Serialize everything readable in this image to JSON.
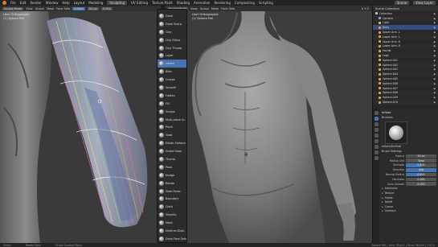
{
  "menubar": {
    "items": [
      "File",
      "Edit",
      "Render",
      "Window",
      "Help",
      "Layout",
      "Modeling",
      "Sculpting",
      "UV Editing",
      "Texture Paint",
      "Shading",
      "Animation",
      "Rendering",
      "Compositing",
      "Scripting"
    ],
    "workspace": "Scene",
    "view_layer": "View Layer"
  },
  "toolbar_left": {
    "mode": "Sculpt Mode",
    "items": [
      "View",
      "Sculpt",
      "Mask",
      "Face Sets"
    ],
    "brush": "Inflate",
    "radius": "50 px",
    "strength": "0.500"
  },
  "toolbar_right": {
    "mode": "Sculpt Mode",
    "items": [
      "View",
      "Sculpt",
      "Mask",
      "Face Sets"
    ],
    "xyz": "X Y Z"
  },
  "viewport_left": {
    "line1": "User Orthographic",
    "line2": "(1) Sphere Pell"
  },
  "viewport_right": {
    "line1": "User Orthographic",
    "line2": "(1) Sphere Pell"
  },
  "brush_menu": {
    "items": [
      "Draw",
      "Draw Sharp",
      "Clay",
      "Clay Strips",
      "Clay Thumb",
      "Layer",
      "Inflate",
      "Blob",
      "Crease",
      "Smooth",
      "Flatten",
      "Fill",
      "Scrape",
      "Multi-plane Sc.",
      "Pinch",
      "Grab",
      "Elastic Deform",
      "Snake Hook",
      "Thumb",
      "Pose",
      "Nudge",
      "Rotate",
      "Slide Relax",
      "Boundary",
      "Cloth",
      "Simplify",
      "Mask",
      "Multires Displ.",
      "Draw Face Sets",
      "Box Mask"
    ],
    "active": "Inflate"
  },
  "outliner": {
    "title": "Scene Collection",
    "rows": [
      {
        "label": "Collection",
        "color": "#c9c9c9"
      },
      {
        "label": "Camera",
        "color": "#8fa8c8"
      },
      {
        "label": "Light",
        "color": "#e0c060"
      },
      {
        "label": "Body",
        "color": "#e0a050"
      },
      {
        "label": "Upper Arm .L",
        "color": "#e0a050"
      },
      {
        "label": "Lower Arm .L",
        "color": "#e0a050"
      },
      {
        "label": "Upper Arm .R",
        "color": "#e0a050"
      },
      {
        "label": "Lower Arm .R",
        "color": "#e0a050"
      },
      {
        "label": "Hands",
        "color": "#e0a050"
      },
      {
        "label": "Legs",
        "color": "#e0a050"
      },
      {
        "label": "Sphere.001",
        "color": "#e0a050"
      },
      {
        "label": "Sphere.002",
        "color": "#e0a050"
      },
      {
        "label": "Sphere.003",
        "color": "#e0a050"
      },
      {
        "label": "Sphere.004",
        "color": "#e0a050"
      },
      {
        "label": "Sphere.005",
        "color": "#e0a050"
      },
      {
        "label": "Sphere.006",
        "color": "#e0a050"
      },
      {
        "label": "Sphere.007",
        "color": "#e0a050"
      },
      {
        "label": "Sphere.008",
        "color": "#e0a050"
      },
      {
        "label": "Sphere.009",
        "color": "#e0a050"
      },
      {
        "label": "Sphere.010",
        "color": "#e0a050"
      }
    ]
  },
  "properties": {
    "tool_name": "Inflate",
    "section_brushes": "Brushes",
    "brush_name": "Inflate/Deflate",
    "section_settings": "Brush Settings",
    "fields": [
      {
        "label": "Radius",
        "value": "50 px",
        "fill": 0
      },
      {
        "label": "Radius Unit",
        "value": "View",
        "fill": 0
      },
      {
        "label": "Strength",
        "value": "0.500",
        "fill": 0.5
      },
      {
        "label": "Direction",
        "value": "Add",
        "fill": 0
      },
      {
        "label": "Normal Radius",
        "value": "0.500",
        "fill": 0.5
      },
      {
        "label": "Hardness",
        "value": "0.000",
        "fill": 0
      },
      {
        "label": "Auto-Smooth",
        "value": "0.000",
        "fill": 0
      }
    ],
    "subpanels": [
      "Advanced",
      "Texture",
      "Stroke",
      "Falloff",
      "Cursor",
      "Overlays"
    ]
  },
  "statusbar": {
    "left": "Select",
    "middle": "Rotate View",
    "right_action": "Sculpt Context Menu",
    "stats": "Sphere Pell | Verts 38,402 | Faces 38,400 | 2.91.0"
  },
  "colors": {
    "accent": "#4772b3",
    "brand": "#e87d0d"
  }
}
